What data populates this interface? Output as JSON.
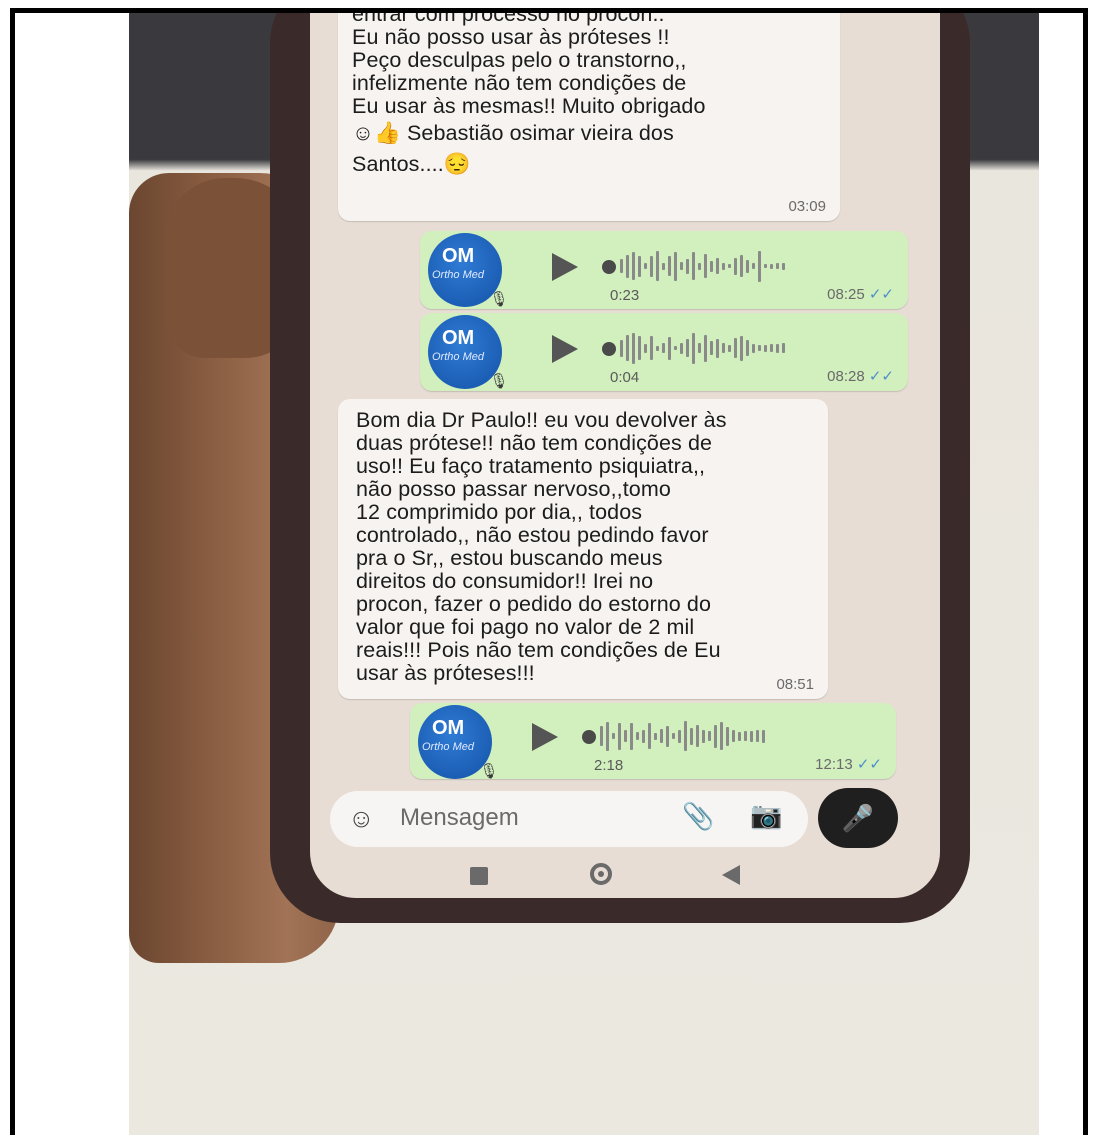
{
  "chat": {
    "messages": [
      {
        "type": "text",
        "direction": "incoming",
        "lines": [
          "entrar com processo no procon..",
          "Eu não posso usar às próteses !!",
          "Peço desculpas pelo o transtorno,,",
          "infelizmente não tem condições de",
          "Eu usar às mesmas!! Muito obrigado",
          "☺👍 Sebastião osimar vieira dos",
          "Santos....😔"
        ],
        "time": "03:09"
      },
      {
        "type": "audio",
        "direction": "outgoing",
        "duration": "0:23",
        "time": "08:25",
        "status": "✓✓"
      },
      {
        "type": "audio",
        "direction": "outgoing",
        "duration": "0:04",
        "time": "08:28",
        "status": "✓✓"
      },
      {
        "type": "text",
        "direction": "incoming",
        "lines": [
          "Bom dia Dr Paulo!! eu vou devolver às",
          "duas prótese!! não tem condições de",
          "uso!! Eu faço tratamento psiquiatra,,",
          "não posso passar nervoso,,tomo",
          "12 comprimido por dia,, todos",
          "controlado,, não estou pedindo favor",
          "pra o Sr,, estou buscando meus",
          "direitos do consumidor!! Irei no",
          "procon, fazer o pedido do estorno do",
          "valor que foi pago no valor de 2 mil",
          "reais!!! Pois não tem condições de Eu",
          "usar às próteses!!!"
        ],
        "time": "08:51"
      },
      {
        "type": "audio",
        "direction": "outgoing",
        "duration": "2:18",
        "time": "12:13",
        "status": "✓✓"
      }
    ],
    "sender_avatar": {
      "logo_text": "OM",
      "logo_subtext": "Ortho Med"
    }
  },
  "composer": {
    "placeholder": "Mensagem",
    "emoji_icon": "emoji-icon",
    "attach_icon": "paperclip-icon",
    "camera_icon": "camera-icon",
    "mic_icon": "microphone-icon"
  },
  "nav": {
    "recents_icon": "square-icon",
    "home_icon": "circle-icon",
    "back_icon": "triangle-back-icon"
  },
  "colors": {
    "chat_background": "#e7ddd4",
    "incoming_bubble": "#f6f3f0",
    "outgoing_bubble": "#d2efbe",
    "avatar_blue": "#1f63c0",
    "read_ticks": "#4f8fc9"
  }
}
